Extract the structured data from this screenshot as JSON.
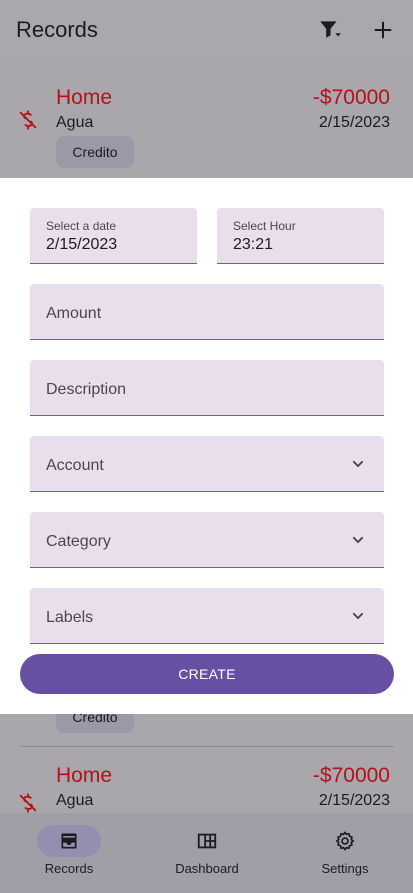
{
  "appbar": {
    "title": "Records",
    "filter_icon": "filter-icon",
    "add_icon": "plus-icon"
  },
  "records": [
    {
      "title": "Home",
      "account": "Agua",
      "amount": "-$70000",
      "date": "2/15/2023",
      "chip": "Credito",
      "icon": "money-off-icon"
    },
    {
      "chip": "Credito"
    },
    {
      "title": "Home",
      "account": "Agua",
      "amount": "-$70000",
      "date": "2/15/2023",
      "icon": "money-off-icon"
    }
  ],
  "form": {
    "date": {
      "label": "Select a date",
      "value": "2/15/2023"
    },
    "hour": {
      "label": "Select Hour",
      "value": "23:21"
    },
    "amount": {
      "placeholder": "Amount"
    },
    "description": {
      "placeholder": "Description"
    },
    "account": {
      "placeholder": "Account"
    },
    "category": {
      "placeholder": "Category"
    },
    "labels": {
      "placeholder": "Labels"
    },
    "create_label": "CREATE"
  },
  "bottom_nav": {
    "active": "Records",
    "items": [
      {
        "label": "Records",
        "icon": "inbox-icon"
      },
      {
        "label": "Dashboard",
        "icon": "dashboard-icon"
      },
      {
        "label": "Settings",
        "icon": "gear-icon"
      }
    ]
  },
  "colors": {
    "expense": "#b3121b",
    "primary": "#6750a4",
    "field_bg": "#e8deec"
  }
}
